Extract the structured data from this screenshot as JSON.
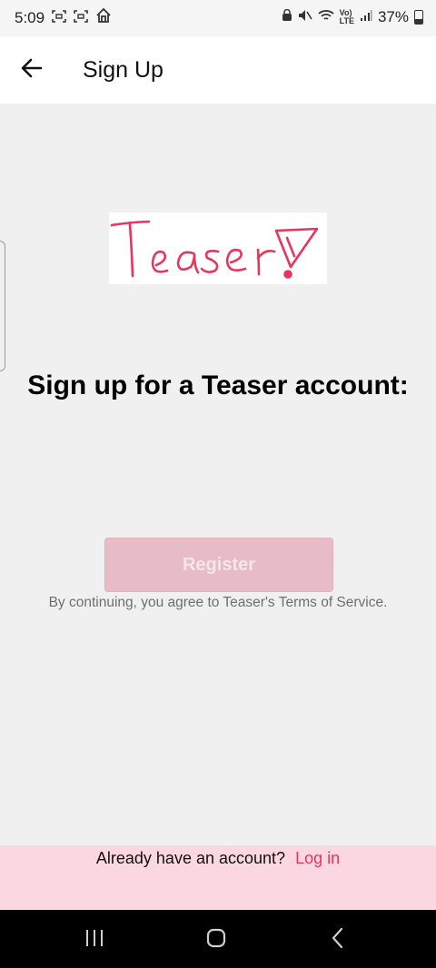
{
  "status_bar": {
    "time": "5:09",
    "battery": "37%",
    "icons": [
      "screenshot-icon",
      "screenshot-icon",
      "home-app-icon",
      "lock-icon",
      "mute-icon",
      "wifi-icon",
      "volte-icon",
      "signal-icon",
      "battery-icon"
    ]
  },
  "app_bar": {
    "title": "Sign Up",
    "back_icon": "arrow-left-icon"
  },
  "logo": {
    "text": "Teaser!",
    "color": "#e8355c"
  },
  "main": {
    "heading": "Sign up for a Teaser account:",
    "register_label": "Register",
    "terms": "By continuing, you agree to Teaser's Terms of Service."
  },
  "footer": {
    "prompt": "Already have an account?",
    "login_label": "Log in"
  },
  "nav": {
    "icons": [
      "recents-icon",
      "home-icon",
      "back-icon"
    ]
  },
  "colors": {
    "accent": "#e8355c",
    "register_disabled": "#e8bcc6",
    "footer_bg": "#fbd7e1"
  }
}
